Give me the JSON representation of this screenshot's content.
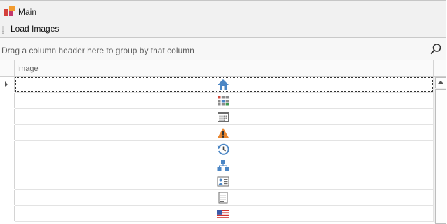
{
  "window": {
    "title": "Main"
  },
  "toolbar": {
    "load_images_label": "Load Images"
  },
  "group_panel": {
    "hint": "Drag a column header here to group by that column"
  },
  "grid": {
    "column_header": "Image",
    "rows": [
      {
        "icon": "home-icon"
      },
      {
        "icon": "tiles-icon"
      },
      {
        "icon": "calendar-icon"
      },
      {
        "icon": "warning-icon"
      },
      {
        "icon": "history-icon"
      },
      {
        "icon": "org-chart-icon"
      },
      {
        "icon": "contact-card-icon"
      },
      {
        "icon": "document-icon"
      },
      {
        "icon": "us-flag-icon"
      }
    ]
  },
  "colors": {
    "icon_blue": "#4b86c5",
    "warning_orange": "#e9872f",
    "icon_gray": "#6d6d6d"
  }
}
